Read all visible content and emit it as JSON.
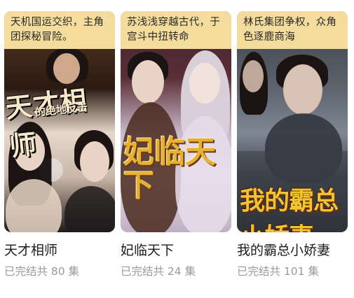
{
  "dramas": [
    {
      "tagline": "天机国运交织，主角团探秘冒险。",
      "poster_title": "天才相师",
      "poster_subtitle": "的绝地反击",
      "name": "天才相师",
      "status": "已完结共 80 集"
    },
    {
      "tagline": "苏浅浅穿越古代，于宫斗中扭转命",
      "poster_title": "妃临天下",
      "name": "妃临天下",
      "status": "已完结共 24 集"
    },
    {
      "tagline": "林氏集团争权，众角色逐鹿商海",
      "poster_title": "我的霸总小娇妻",
      "name": "我的霸总小娇妻",
      "status": "已完结共 101 集"
    }
  ],
  "colors": {
    "tagline_bg": "#f4dc9d",
    "name_text": "#1d1d1d",
    "meta_text": "#9a9a9a"
  }
}
